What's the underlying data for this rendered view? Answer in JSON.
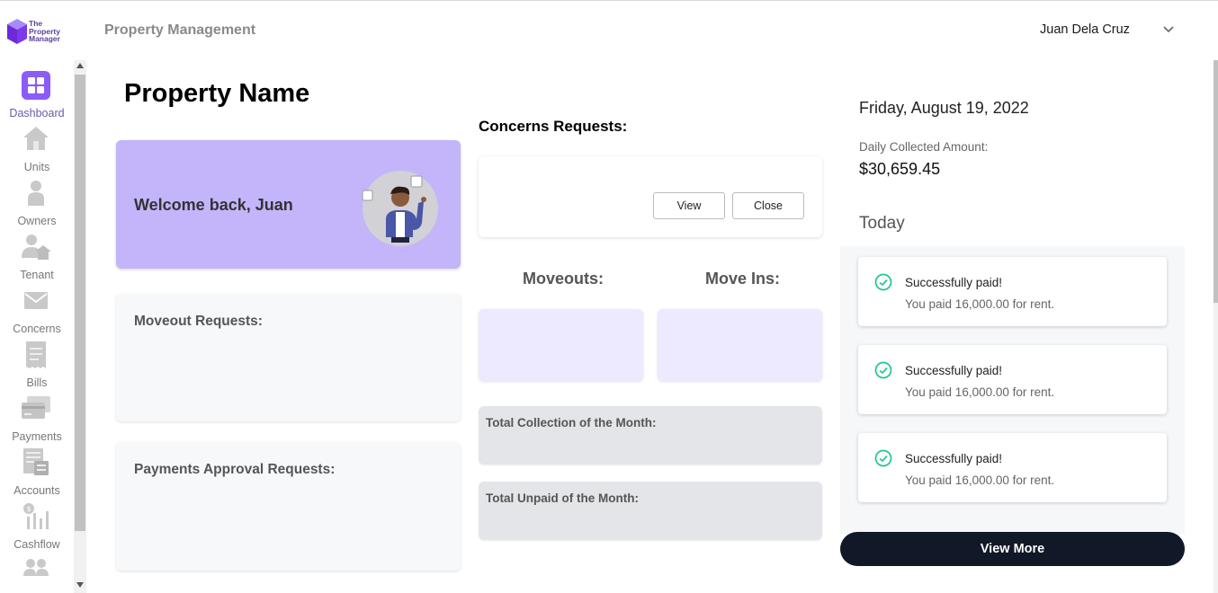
{
  "header": {
    "logo_text": [
      "The",
      "Property",
      "Manager"
    ],
    "app_title": "Property Management",
    "user_name": "Juan Dela Cruz",
    "user_menu_icon": "chevron-down-icon"
  },
  "sidebar": {
    "items": [
      {
        "label": "Dashboard",
        "icon": "dashboard-icon",
        "active": true
      },
      {
        "label": "Units",
        "icon": "home-icon",
        "active": false
      },
      {
        "label": "Owners",
        "icon": "person-icon",
        "active": false
      },
      {
        "label": "Tenant",
        "icon": "tenant-icon",
        "active": false
      },
      {
        "label": "Concerns",
        "icon": "mail-icon",
        "active": false
      },
      {
        "label": "Bills",
        "icon": "receipt-icon",
        "active": false
      },
      {
        "label": "Payments",
        "icon": "credit-card-icon",
        "active": false
      },
      {
        "label": "Accounts",
        "icon": "ledger-icon",
        "active": false
      },
      {
        "label": "Cashflow",
        "icon": "cashflow-icon",
        "active": false
      },
      {
        "label": "",
        "icon": "users-icon",
        "active": false
      }
    ]
  },
  "main": {
    "page_title": "Property Name",
    "welcome_text": "Welcome back, Juan",
    "moveout_requests_title": "Moveout Requests:",
    "payments_approval_title": "Payments Approval Requests:",
    "concerns_title": "Concerns Requests:",
    "concerns_view_label": "View",
    "concerns_close_label": "Close",
    "moveouts_title": "Moveouts:",
    "moveins_title": "Move Ins:",
    "total_collection_label": "Total Collection of the Month:",
    "total_unpaid_label": "Total Unpaid of the Month:"
  },
  "right_panel": {
    "date": "Friday, August 19, 2022",
    "daily_collected_label": "Daily Collected Amount:",
    "daily_collected_amount": "$30,659.45",
    "today_label": "Today",
    "notifications": [
      {
        "title": "Successfully paid!",
        "message": "You paid 16,000.00 for rent.",
        "icon": "check-circle-icon"
      },
      {
        "title": "Successfully paid!",
        "message": "You paid 16,000.00 for rent.",
        "icon": "check-circle-icon"
      },
      {
        "title": "Successfully paid!",
        "message": "You paid 16,000.00 for rent.",
        "icon": "check-circle-icon"
      }
    ],
    "view_more_label": "View More"
  },
  "colors": {
    "accent": "#8b5cf6",
    "welcome_bg": "#c4b5fb",
    "move_box_bg": "#ede9fe",
    "success": "#22c58b",
    "dark_button": "#111827"
  }
}
